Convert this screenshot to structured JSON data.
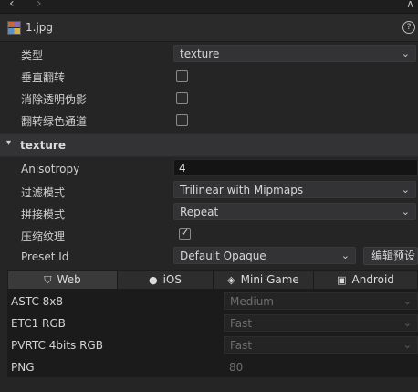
{
  "file": {
    "name": "1.jpg",
    "help": "?"
  },
  "props": {
    "type_label": "类型",
    "type_value": "texture",
    "flip_vertical_label": "垂直翻转",
    "premultiply_alpha_label": "消除透明伪影",
    "flip_green_label": "翻转绿色通道"
  },
  "texture": {
    "section_title": "texture",
    "anisotropy_label": "Anisotropy",
    "anisotropy_value": "4",
    "filter_label": "过滤模式",
    "filter_value": "Trilinear with Mipmaps",
    "wrap_label": "拼接模式",
    "wrap_value": "Repeat",
    "compress_label": "压缩纹理",
    "compress_checked": true,
    "preset_label": "Preset Id",
    "preset_value": "Default Opaque",
    "edit_preset_label": "编辑预设"
  },
  "tabs": [
    {
      "label": "Web",
      "icon": "html5-icon",
      "active": true
    },
    {
      "label": "iOS",
      "icon": "apple-icon",
      "active": false
    },
    {
      "label": "Mini Game",
      "icon": "gamepad-icon",
      "active": false
    },
    {
      "label": "Android",
      "icon": "android-icon",
      "active": false
    }
  ],
  "formats": [
    {
      "label": "ASTC 8x8",
      "value": "Medium"
    },
    {
      "label": "ETC1 RGB",
      "value": "Fast"
    },
    {
      "label": "PVRTC 4bits RGB",
      "value": "Fast"
    },
    {
      "label": "PNG",
      "value": "80"
    }
  ]
}
